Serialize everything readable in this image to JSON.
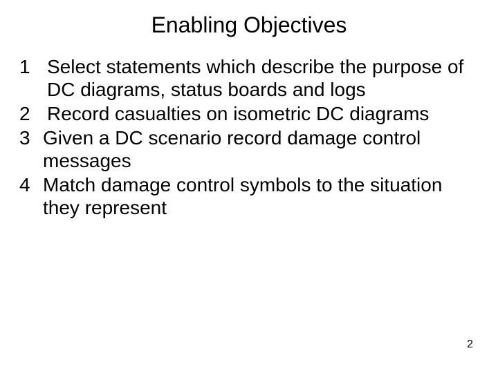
{
  "title": "Enabling Objectives",
  "items": [
    {
      "n": "1",
      "text": "Select statements which describe the purpose of DC diagrams, status boards and logs"
    },
    {
      "n": "2",
      "text": "Record casualties on isometric DC diagrams"
    },
    {
      "n": "3",
      "text": "Given a DC scenario record damage control messages"
    },
    {
      "n": "4",
      "text": "Match damage control symbols to the situation they represent"
    }
  ],
  "page_number": "2"
}
